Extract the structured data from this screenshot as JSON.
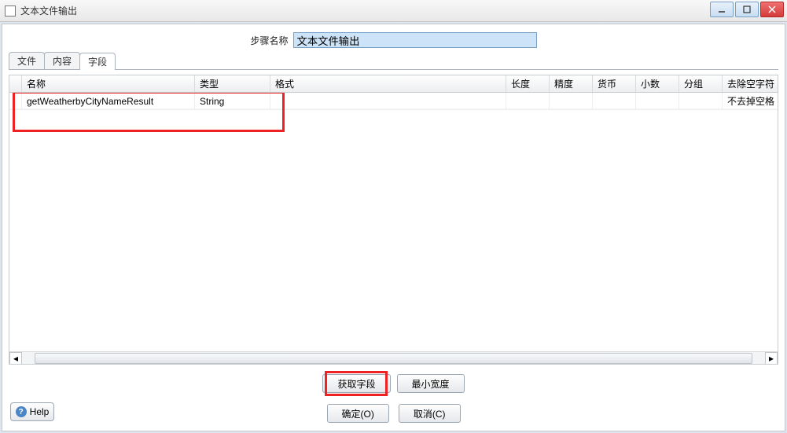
{
  "window": {
    "title": "文本文件输出"
  },
  "step": {
    "label": "步骤名称",
    "value": "文本文件输出"
  },
  "tabs": {
    "file": "文件",
    "content": "内容",
    "fields": "字段"
  },
  "grid": {
    "columns": {
      "name": "名称",
      "type": "类型",
      "format": "格式",
      "length": "长度",
      "precision": "精度",
      "currency": "货币",
      "decimal": "小数",
      "group": "分组",
      "trim": "去除空字符"
    },
    "rows": [
      {
        "name": "getWeatherbyCityNameResult",
        "type": "String",
        "format": "",
        "length": "",
        "precision": "",
        "currency": "",
        "decimal": "",
        "group": "",
        "trim": "不去掉空格"
      }
    ]
  },
  "actions": {
    "get_fields": "获取字段",
    "min_width": "最小宽度"
  },
  "buttons": {
    "ok": "确定(O)",
    "cancel": "取消(C)",
    "help": "Help"
  }
}
